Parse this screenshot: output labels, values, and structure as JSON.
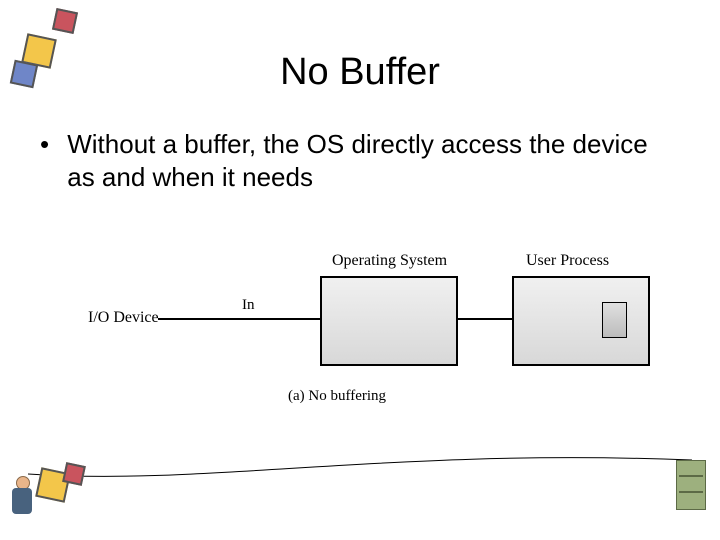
{
  "title": "No Buffer",
  "bullet": {
    "marker": "•",
    "text": "Without a buffer, the OS directly access the device as and when it needs"
  },
  "diagram": {
    "os_label": "Operating System",
    "user_process_label": "User Process",
    "io_device_label": "I/O Device",
    "in_label": "In",
    "caption": "(a) No buffering"
  },
  "decorations": {
    "top_left_icon": "cubes-clipart",
    "bottom_left_icon": "person-with-cubes-clipart",
    "bottom_right_icon": "server-rack-clipart"
  }
}
